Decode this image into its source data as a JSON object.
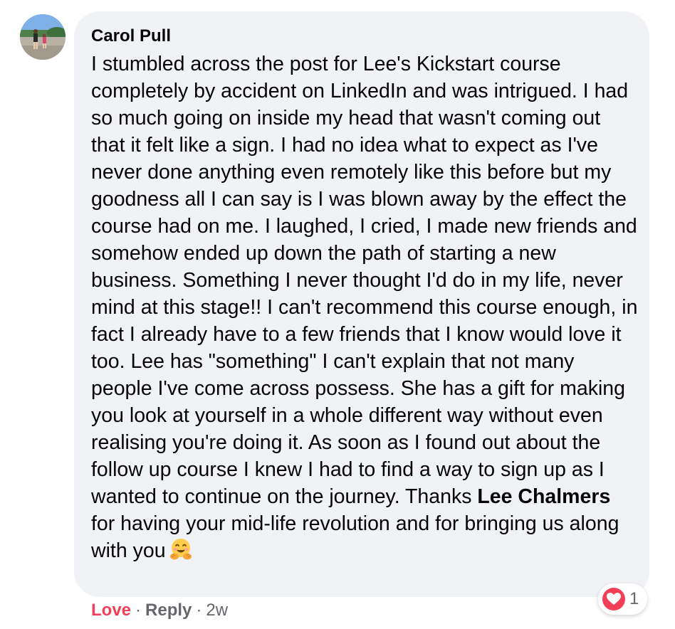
{
  "comment": {
    "author": "Carol Pull",
    "body_part1": "I stumbled across the post for Lee's Kickstart course completely by accident on LinkedIn and was intrigued. I had so much going on inside my head that wasn't coming out that it felt like a sign. I had no idea what to expect as I've never done anything even remotely like this before but my goodness all I can say is I was blown away by the effect the course had on me. I laughed, I cried, I made new friends and somehow ended up down the path of starting a new business. Something I never thought I'd do in my life, never mind at this stage!! I can't recommend this course enough, in fact I already have to a few friends that I know would love it too. Lee has \"something\" I can't explain that not many people I've come across possess. She has a gift for making you look at yourself in a whole different way without even realising you're doing it. As soon as I found out about the follow up course I knew I had to find a way to sign up as I wanted to continue on the journey. Thanks ",
    "mention": "Lee Chalmers",
    "body_part2": " for having your mid-life revolution and for bringing us along with you",
    "emoji_icon": "hugging-face-emoji",
    "reaction": {
      "icon": "love-heart-icon",
      "count": "1",
      "color": "#f33e58"
    }
  },
  "actions": {
    "love_label": "Love",
    "separator": "·",
    "reply_label": "Reply",
    "timestamp": "2w"
  },
  "colors": {
    "bubble_bg": "#f0f2f5",
    "text": "#050505",
    "secondary": "#65676b",
    "love": "#f33e58"
  }
}
